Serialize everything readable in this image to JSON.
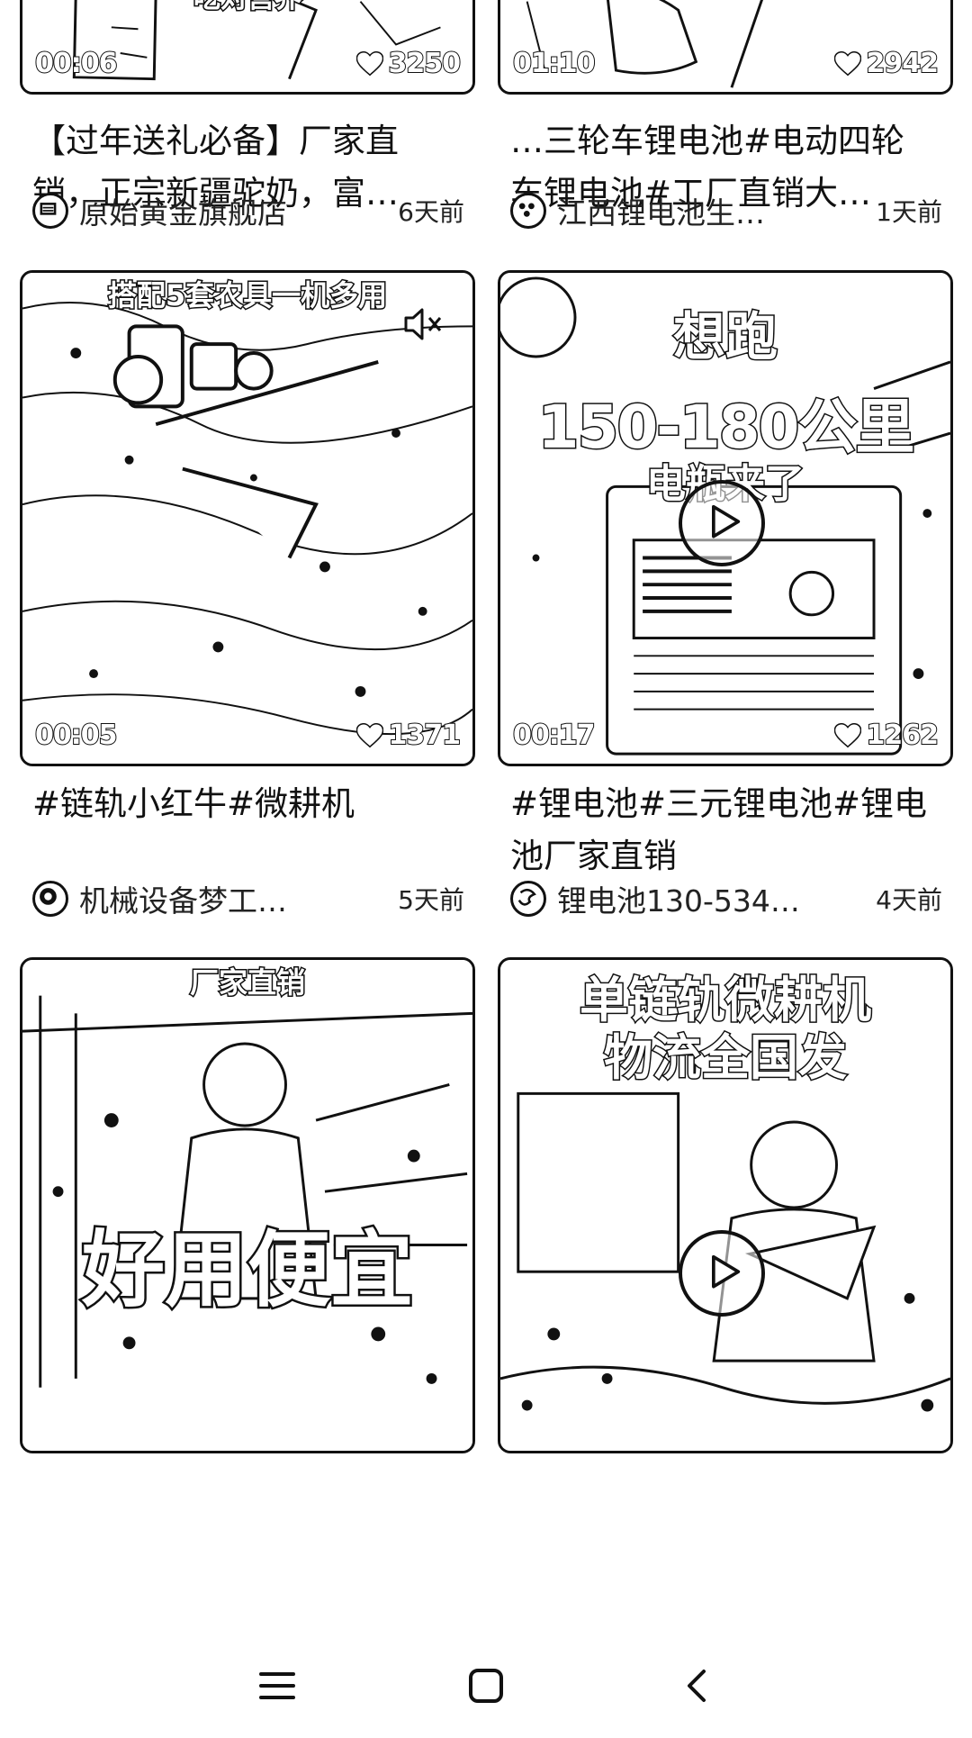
{
  "feed": {
    "left": [
      {
        "duration": "00:06",
        "likes": "3250",
        "overlay": "吃对营养",
        "title": "【过年送礼必备】厂家直销，正宗新疆驼奶，富…",
        "author": "原始黄金旗舰店",
        "time": "6天前",
        "avatar_icon": "shop-logo-icon"
      },
      {
        "duration": "00:05",
        "likes": "1371",
        "overlay_top": "搭配5套农具一机多用",
        "title": "#链轨小红牛#微耕机",
        "author": "机械设备梦工…",
        "time": "5天前",
        "avatar_icon": "machine-logo-icon",
        "mute_icon": "speaker-muted-icon"
      },
      {
        "overlay_top": "厂家直销",
        "overlay_big": "好用便宜"
      }
    ],
    "right": [
      {
        "duration": "01:10",
        "likes": "2942",
        "title": "…三轮车锂电池#电动四轮车锂电池#工厂直销大…",
        "author": "江西锂电池生…",
        "time": "1天前",
        "avatar_icon": "battery-logo-icon"
      },
      {
        "duration": "00:17",
        "likes": "1262",
        "overlay_l1": "想跑",
        "overlay_l2": "150-180公里",
        "overlay_l3": "电瓶来了",
        "title": "#锂电池#三元锂电池#锂电池厂家直销",
        "author": "锂电池130-534…",
        "time": "4天前",
        "avatar_icon": "swirl-logo-icon",
        "play_icon": "play-icon"
      },
      {
        "overlay_l1": "单链轨微耕机",
        "overlay_l2": "物流全国发",
        "play_icon": "play-icon"
      }
    ]
  },
  "navbar": {
    "menu_icon": "menu-icon",
    "home_icon": "home-square-icon",
    "back_icon": "back-chevron-icon"
  }
}
